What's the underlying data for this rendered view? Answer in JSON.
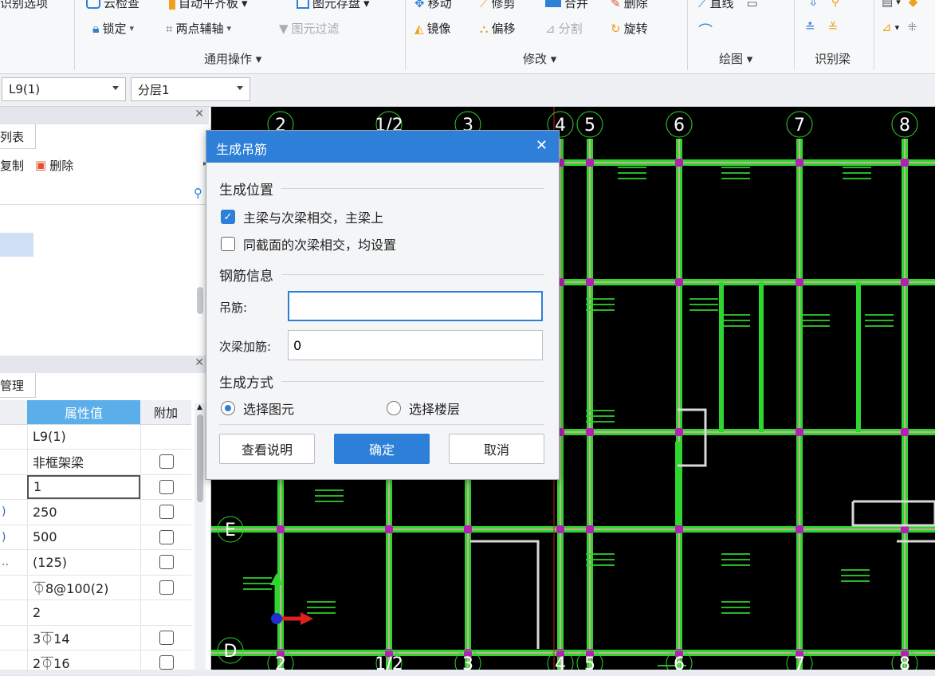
{
  "ribbon": {
    "top_row": [
      {
        "label": "识别选项"
      },
      {
        "label": "云检查"
      },
      {
        "label": "自动平齐板"
      },
      {
        "label": "图元存盘"
      },
      {
        "label": "移动"
      },
      {
        "label": "修剪"
      },
      {
        "label": "合并"
      },
      {
        "label": "删除"
      },
      {
        "label": "直线"
      }
    ],
    "row2": {
      "lock": "锁定",
      "two_point_axis": "两点辅轴",
      "filter": "图元过滤",
      "mirror": "镜像",
      "offset": "偏移",
      "split": "分割",
      "rotate": "旋转"
    },
    "groups": {
      "common_ops": "通用操作",
      "modify": "修改",
      "draw": "绘图",
      "identify_beam": "识别梁"
    }
  },
  "toolbar": {
    "element_select": "L9(1)",
    "layer_select": "分层1"
  },
  "left_panel": {
    "list_tab": "列表",
    "copy_btn": "复制",
    "delete_btn": "删除",
    "manage_tab": "管理",
    "prop_header_value": "属性值",
    "prop_header_add": "附加",
    "props": [
      {
        "label": "",
        "value": "L9(1)",
        "check": false
      },
      {
        "label": "",
        "value": "非框架梁",
        "check": true
      },
      {
        "label": "",
        "value": "1",
        "check": true
      },
      {
        "label": ")",
        "value": "250",
        "check": true
      },
      {
        "label": ")",
        "value": "500",
        "check": true
      },
      {
        "label": "..",
        "value": "(125)",
        "check": true
      },
      {
        "label": "",
        "value": "⏁8@100(2)",
        "check": true
      },
      {
        "label": "",
        "value": "2",
        "check": false
      },
      {
        "label": "",
        "value": "3⏁14",
        "check": true
      },
      {
        "label": "",
        "value": "2⏁16",
        "check": true
      }
    ]
  },
  "dialog": {
    "title": "生成吊筋",
    "section_position": "生成位置",
    "opt_main_secondary": "主梁与次梁相交，主梁上",
    "opt_same_section": "同截面的次梁相交，均设置",
    "section_rebar": "钢筋信息",
    "hanger_label": "吊筋:",
    "hanger_value": "",
    "secondary_label": "次梁加筋:",
    "secondary_value": "0",
    "section_method": "生成方式",
    "method_select_element": "选择图元",
    "method_select_floor": "选择楼层",
    "btn_help": "查看说明",
    "btn_ok": "确定",
    "btn_cancel": "取消"
  },
  "canvas": {
    "axis_labels_top": [
      "2",
      "1/2",
      "3",
      "4",
      "5",
      "6",
      "7",
      "8"
    ],
    "axis_labels_left": [
      "E",
      "D"
    ],
    "axis_labels_bottom": [
      "2",
      "1/2",
      "3",
      "4",
      "5",
      "6",
      "7",
      "8"
    ]
  }
}
